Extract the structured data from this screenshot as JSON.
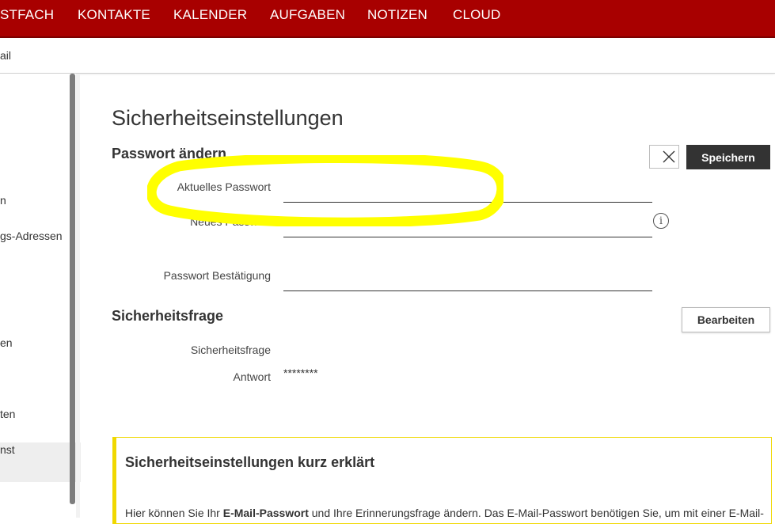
{
  "topnav": {
    "items": [
      "STFACH",
      "KONTAKTE",
      "KALENDER",
      "AUFGABEN",
      "NOTIZEN",
      "CLOUD"
    ]
  },
  "subbar": {
    "crumb": "ail"
  },
  "sidebar": {
    "items": [
      "n",
      "gs-Adressen",
      "en",
      "ten",
      "nst"
    ]
  },
  "page": {
    "title": "Sicherheitseinstellungen"
  },
  "password_section": {
    "title": "Passwort ändern",
    "current_label": "Aktuelles Passwort",
    "current_value": "",
    "new_label": "Neues Passwort",
    "new_value": "",
    "confirm_label": "Passwort Bestätigung",
    "confirm_value": "",
    "info_icon": "info-icon",
    "cancel_icon": "close-icon",
    "save_label": "Speichern"
  },
  "question_section": {
    "title": "Sicherheitsfrage",
    "question_label": "Sicherheitsfrage",
    "question_value": "",
    "answer_label": "Antwort",
    "answer_value": "********",
    "edit_label": "Bearbeiten"
  },
  "infobox": {
    "title": "Sicherheitseinstellungen kurz erklärt",
    "text_before": "Hier können Sie Ihr ",
    "text_bold": "E-Mail-Passwort",
    "text_after": " und Ihre Erinnerungsfrage ändern. Das E-Mail-Passwort benötigen Sie, um mit einer E-Mail-"
  },
  "colors": {
    "brand": "#a80000",
    "highlight": "#ffff00",
    "infobox_border": "#f0d800",
    "save_button": "#333333"
  }
}
